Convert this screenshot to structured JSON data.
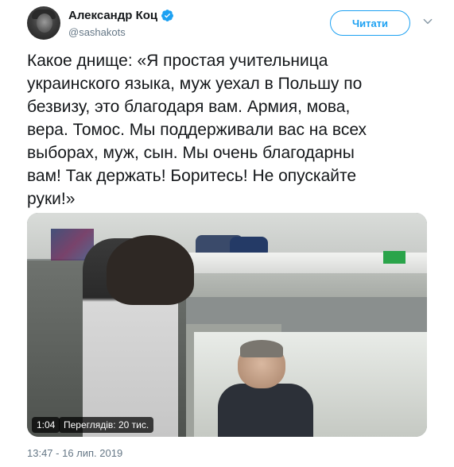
{
  "author": {
    "display_name": "Александр Коц",
    "handle": "@sashakots",
    "verified": true,
    "avatar_icon": "user-avatar"
  },
  "follow_button": {
    "label": "Читати"
  },
  "more_menu": {
    "icon": "chevron-down-icon"
  },
  "tweet": {
    "text": "Какое днище: «Я простая учительница\nукраинского языка, муж уехал в Польшу по\nбезвизу, это благодаря вам. Армия, мова,\nвера. Томос. Мы поддерживали вас на всех\nвыборах, муж, сын. Мы очень благодарны\nвам! Так держать! Боритесь! Не опускайте\nруки!»"
  },
  "video": {
    "duration": "1:04",
    "views": "Переглядів: 20 тис."
  },
  "timestamp": "13:47 - 16 лип. 2019",
  "colors": {
    "accent": "#1da1f2",
    "secondary_text": "#657786",
    "primary_text": "#14171a"
  }
}
